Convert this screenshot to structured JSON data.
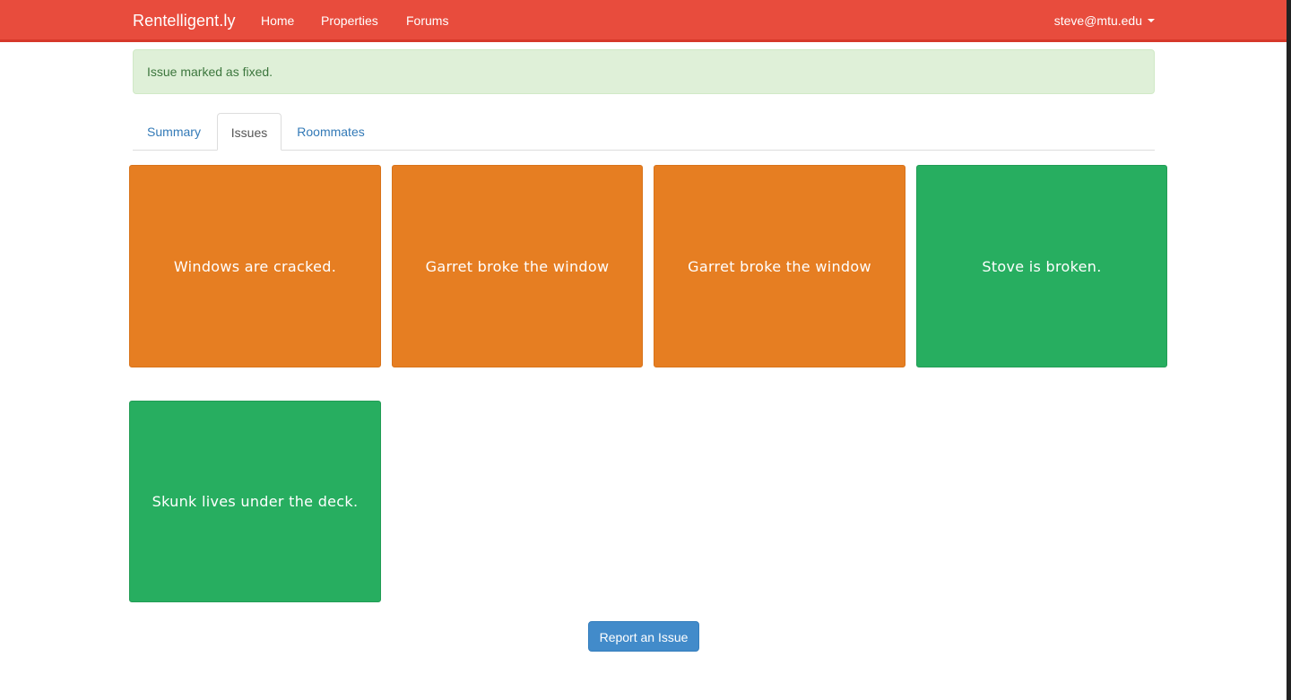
{
  "navbar": {
    "brand": "Rentelligent.ly",
    "links": [
      "Home",
      "Properties",
      "Forums"
    ],
    "user": "steve@mtu.edu"
  },
  "alert": {
    "message": "Issue marked as fixed."
  },
  "tabs": [
    {
      "label": "Summary",
      "active": false
    },
    {
      "label": "Issues",
      "active": true
    },
    {
      "label": "Roommates",
      "active": false
    }
  ],
  "issues": [
    {
      "title": "Windows are cracked.",
      "status_color": "#e67e22"
    },
    {
      "title": "Garret broke the window",
      "status_color": "#e67e22"
    },
    {
      "title": "Garret broke the window",
      "status_color": "#e67e22"
    },
    {
      "title": "Stove is broken.",
      "status_color": "#27ae60"
    },
    {
      "title": "Skunk lives under the deck.",
      "status_color": "#27ae60"
    }
  ],
  "colors": {
    "navbar": "#e84c3d",
    "open_issue": "#e67e22",
    "fixed_issue": "#27ae60",
    "primary_button": "#428bca"
  },
  "actions": {
    "report_issue": "Report an Issue"
  }
}
